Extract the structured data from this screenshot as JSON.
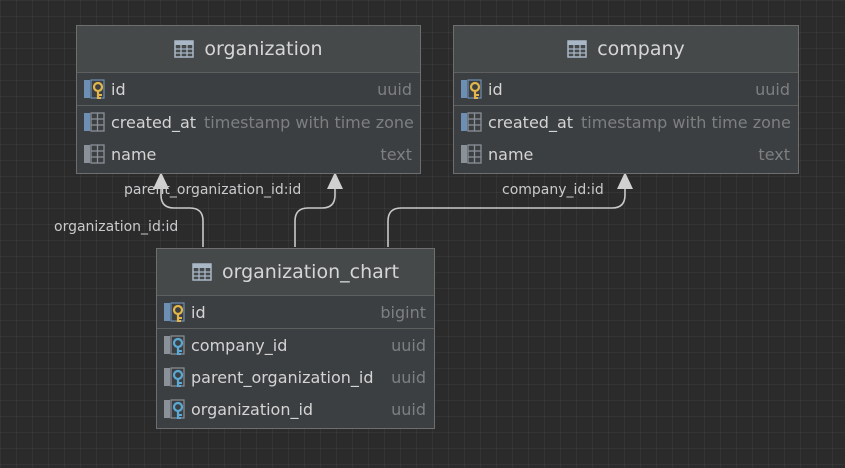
{
  "tables": {
    "organization": {
      "name": "organization",
      "columns": [
        {
          "name": "id",
          "type": "uuid",
          "icon": "primary-key-icon"
        },
        {
          "name": "created_at",
          "type": "timestamp with time zone",
          "icon": "column-icon"
        },
        {
          "name": "name",
          "type": "text",
          "icon": "column-icon"
        }
      ]
    },
    "company": {
      "name": "company",
      "columns": [
        {
          "name": "id",
          "type": "uuid",
          "icon": "primary-key-icon"
        },
        {
          "name": "created_at",
          "type": "timestamp with time zone",
          "icon": "column-icon"
        },
        {
          "name": "name",
          "type": "text",
          "icon": "column-icon"
        }
      ]
    },
    "organization_chart": {
      "name": "organization_chart",
      "columns": [
        {
          "name": "id",
          "type": "bigint",
          "icon": "primary-key-icon"
        },
        {
          "name": "company_id",
          "type": "uuid",
          "icon": "foreign-key-icon"
        },
        {
          "name": "parent_organization_id",
          "type": "uuid",
          "icon": "foreign-key-icon"
        },
        {
          "name": "organization_id",
          "type": "uuid",
          "icon": "foreign-key-icon"
        }
      ]
    }
  },
  "relations": {
    "parent_organization": "parent_organization_id:id",
    "organization": "organization_id:id",
    "company": "company_id:id"
  },
  "colors": {
    "background": "#2b2b2b",
    "table_body": "#3c3f41",
    "table_header": "#45494a",
    "text": "#d4d4d4",
    "type_text": "#7d7f80",
    "primary_key": "#e2b64a",
    "foreign_key": "#5aa9d6",
    "link_line": "#c8c8c8"
  }
}
